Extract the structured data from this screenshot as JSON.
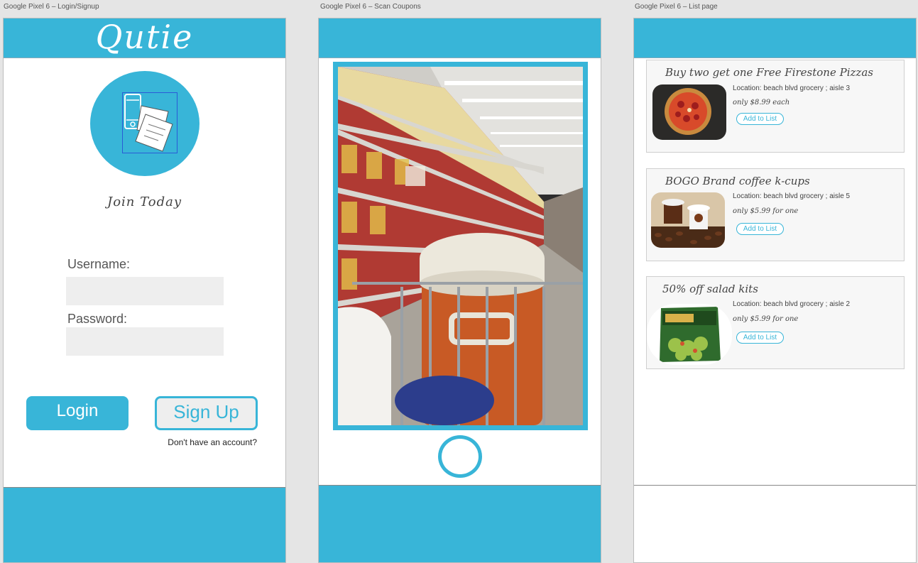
{
  "artboards": [
    {
      "label": "Google Pixel 6 – Login/Signup"
    },
    {
      "label": "Google Pixel 6 – Scan Coupons"
    },
    {
      "label": "Google Pixel 6 – List page"
    }
  ],
  "login": {
    "brand": "Qutie",
    "tagline": "Join Today",
    "username_label": "Username:",
    "password_label": "Password:",
    "username_value": "",
    "password_value": "",
    "login_button": "Login",
    "signup_button": "Sign Up",
    "account_prompt": "Don't have an account?"
  },
  "scan": {
    "camera_image": "grocery-aisle-photo",
    "shutter_icon": "capture-circle-icon"
  },
  "list": {
    "items": [
      {
        "title": "Buy two get one Free Firestone Pizzas",
        "location": "Location: beach blvd grocery ; aisle 3",
        "price": "only $8.99 each",
        "button": "Add to List",
        "image": "pizza-image"
      },
      {
        "title": "BOGO Brand coffee k-cups",
        "location": "Location: beach blvd grocery ; aisle 5",
        "price": "only $5.99 for one",
        "button": "Add to List",
        "image": "coffee-kcups-image"
      },
      {
        "title": "50% off salad kits",
        "location": "Location: beach blvd grocery ; aisle 2",
        "price": "only $5.99 for one",
        "button": "Add to List",
        "image": "salad-kit-image"
      }
    ]
  },
  "colors": {
    "accent": "#38b5d8",
    "field_bg": "#eeeeee",
    "canvas": "#e5e5e5"
  }
}
